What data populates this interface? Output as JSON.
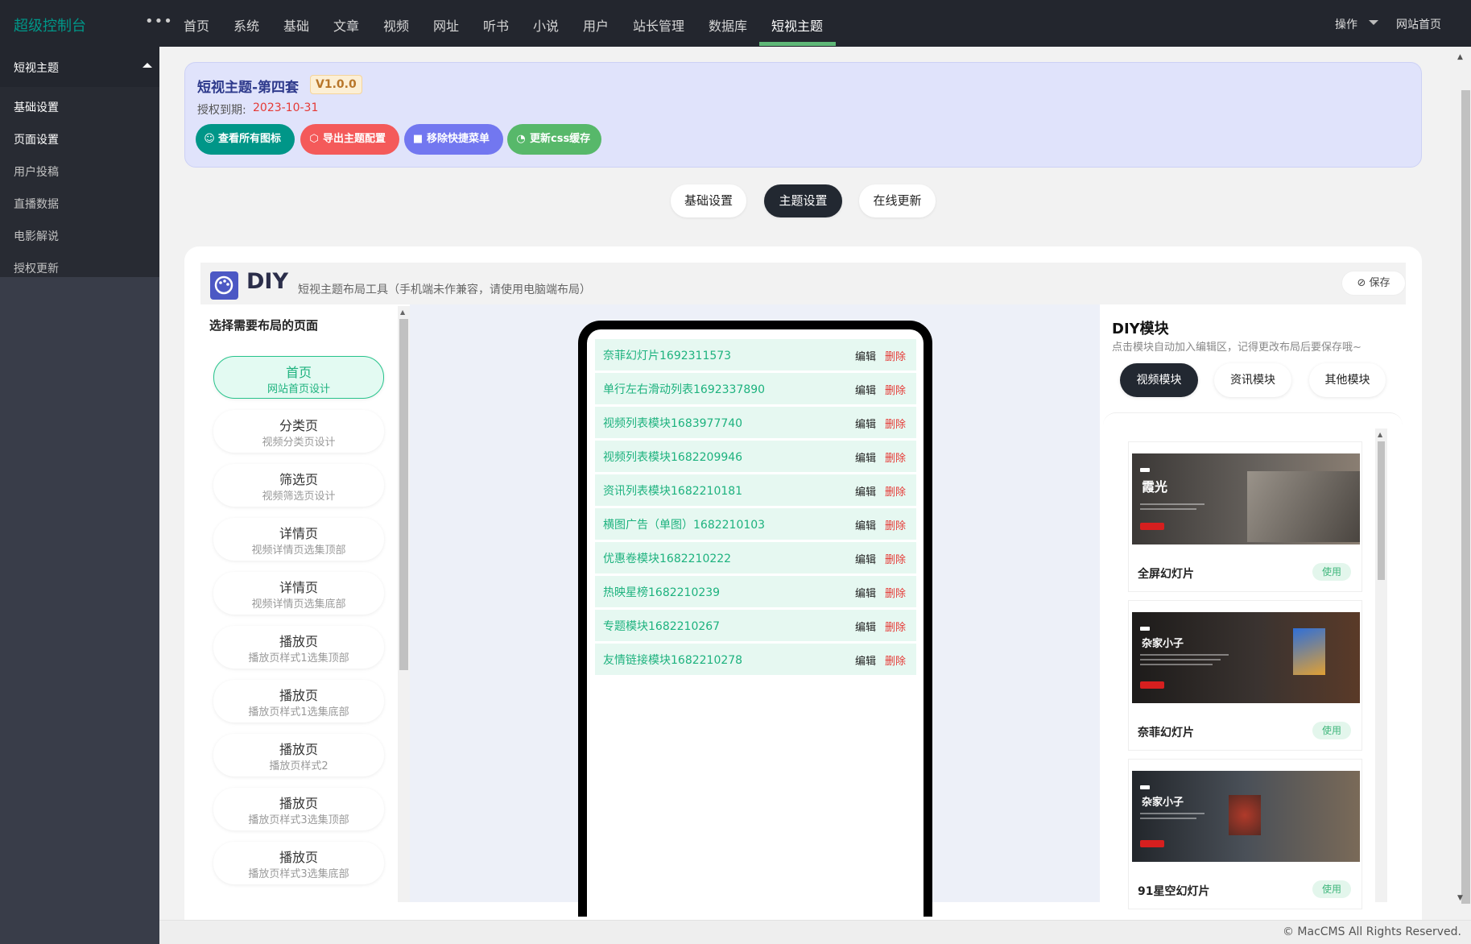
{
  "topbar": {
    "logo": "超级控制台",
    "more": "•••",
    "nav": [
      "首页",
      "系统",
      "基础",
      "文章",
      "视频",
      "网址",
      "听书",
      "小说",
      "用户",
      "站长管理",
      "数据库",
      "短视主题"
    ],
    "active_nav": "短视主题",
    "operate": "操作",
    "site_home": "网站首页"
  },
  "sidebar": {
    "group": "短视主题",
    "items": [
      "基础设置",
      "页面设置",
      "用户投稿",
      "直播数据",
      "电影解说",
      "授权更新"
    ]
  },
  "theme_card": {
    "title": "短视主题-第四套",
    "version": "V1.0.0",
    "auth_label": "授权到期:",
    "auth_date": "2023-10-31",
    "buttons": [
      {
        "label": "查看所有图标",
        "icon": "palette-icon",
        "color": "#009688"
      },
      {
        "label": "导出主题配置",
        "icon": "box-icon",
        "color": "#f45a5a"
      },
      {
        "label": "移除快捷菜单",
        "icon": "trash-icon",
        "color": "#7277f0"
      },
      {
        "label": "更新css缓存",
        "icon": "gauge-icon",
        "color": "#57b86a"
      }
    ]
  },
  "setting_tabs": [
    "基础设置",
    "主题设置",
    "在线更新"
  ],
  "active_setting_tab": "主题设置",
  "diy": {
    "title": "DIY",
    "subtitle": "短视主题布局工具（手机端未作兼容，请使用电脑端布局）",
    "save": "保存"
  },
  "pages_panel": {
    "heading": "选择需要布局的页面",
    "pages": [
      {
        "name": "首页",
        "desc": "网站首页设计"
      },
      {
        "name": "分类页",
        "desc": "视频分类页设计"
      },
      {
        "name": "筛选页",
        "desc": "视频筛选页设计"
      },
      {
        "name": "详情页",
        "desc": "视频详情页选集顶部"
      },
      {
        "name": "详情页",
        "desc": "视频详情页选集底部"
      },
      {
        "name": "播放页",
        "desc": "播放页样式1选集顶部"
      },
      {
        "name": "播放页",
        "desc": "播放页样式1选集底部"
      },
      {
        "name": "播放页",
        "desc": "播放页样式2"
      },
      {
        "name": "播放页",
        "desc": "播放页样式3选集顶部"
      },
      {
        "name": "播放页",
        "desc": "播放页样式3选集底部"
      }
    ]
  },
  "modules": {
    "edit": "编辑",
    "delete": "删除",
    "items": [
      "奈菲幻灯片1692311573",
      "单行左右滑动列表1692337890",
      "视频列表模块1683977740",
      "视频列表模块1682209946",
      "资讯列表模块1682210181",
      "横图广告（单图）1682210103",
      "优惠卷模块1682210222",
      "热映星榜1682210239",
      "专题模块1682210267",
      "友情链接模块1682210278"
    ]
  },
  "diy_modules": {
    "title": "DIY模块",
    "subtitle": "点击模块自动加入编辑区，记得更改布局后要保存哦~",
    "tabs": [
      "视频模块",
      "资讯模块",
      "其他模块"
    ],
    "active_tab": "视频模块",
    "use_label": "使用",
    "templates": [
      {
        "name": "全屏幻灯片",
        "thumb_title": "霞光",
        "bg": "#5a5652"
      },
      {
        "name": "奈菲幻灯片",
        "thumb_title": "杂家小子",
        "bg": "#2e2a28"
      },
      {
        "name": "91星空幻灯片",
        "thumb_title": "杂家小子",
        "bg": "#3a3f45"
      }
    ]
  },
  "footer": "© MacCMS All Rights Reserved."
}
